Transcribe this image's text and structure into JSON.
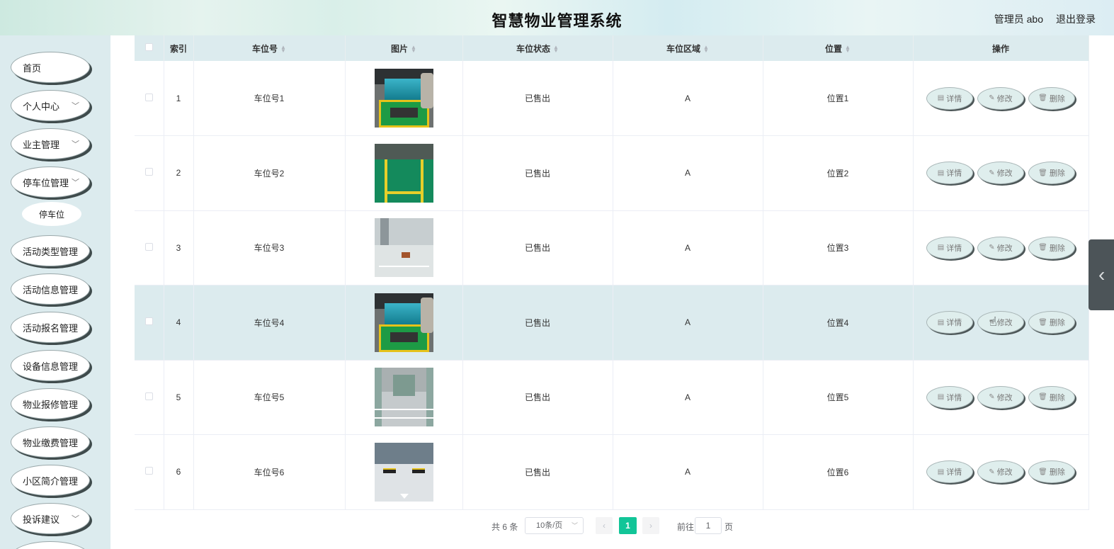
{
  "header": {
    "title": "智慧物业管理系统",
    "user_label": "管理员 abo",
    "logout_label": "退出登录"
  },
  "sidebar": {
    "items": [
      {
        "label": "首页",
        "has_arrow": false
      },
      {
        "label": "个人中心",
        "has_arrow": true
      },
      {
        "label": "业主管理",
        "has_arrow": true
      },
      {
        "label": "停车位管理",
        "has_arrow": true
      },
      {
        "label": "活动类型管理",
        "has_arrow": true
      },
      {
        "label": "活动信息管理",
        "has_arrow": true
      },
      {
        "label": "活动报名管理",
        "has_arrow": true
      },
      {
        "label": "设备信息管理",
        "has_arrow": true
      },
      {
        "label": "物业报修管理",
        "has_arrow": true
      },
      {
        "label": "物业缴费管理",
        "has_arrow": true
      },
      {
        "label": "小区简介管理",
        "has_arrow": true
      },
      {
        "label": "投诉建议",
        "has_arrow": true
      }
    ],
    "submenu": {
      "label": "停车位"
    }
  },
  "table": {
    "columns": [
      "索引",
      "车位号",
      "图片",
      "车位状态",
      "车位区域",
      "位置",
      "操作"
    ],
    "rows": [
      {
        "index": "1",
        "spot": "车位号1",
        "status": "已售出",
        "area": "A",
        "location": "位置1",
        "image": "parking-green-car"
      },
      {
        "index": "2",
        "spot": "车位号2",
        "status": "已售出",
        "area": "A",
        "location": "位置2",
        "image": "parking-green-floor"
      },
      {
        "index": "3",
        "spot": "车位号3",
        "status": "已售出",
        "area": "A",
        "location": "位置3",
        "image": "parking-white-floor"
      },
      {
        "index": "4",
        "spot": "车位号4",
        "status": "已售出",
        "area": "A",
        "location": "位置4",
        "image": "parking-green-car"
      },
      {
        "index": "5",
        "spot": "车位号5",
        "status": "已售出",
        "area": "A",
        "location": "位置5",
        "image": "parking-garage-hall"
      },
      {
        "index": "6",
        "spot": "车位号6",
        "status": "已售出",
        "area": "A",
        "location": "位置6",
        "image": "parking-stoppers"
      }
    ],
    "actions": {
      "detail": "详情",
      "edit": "修改",
      "delete": "删除"
    },
    "hover_row": 3
  },
  "pagination": {
    "total": "共 6 条",
    "page_size": "10条/页",
    "current_page": "1",
    "goto_label": "前往",
    "goto_value": "1",
    "page_unit": "页"
  },
  "colors": {
    "accent": "#12c598",
    "sidebar_bg": "#dcebee",
    "header_row_bg": "#dcebee"
  }
}
